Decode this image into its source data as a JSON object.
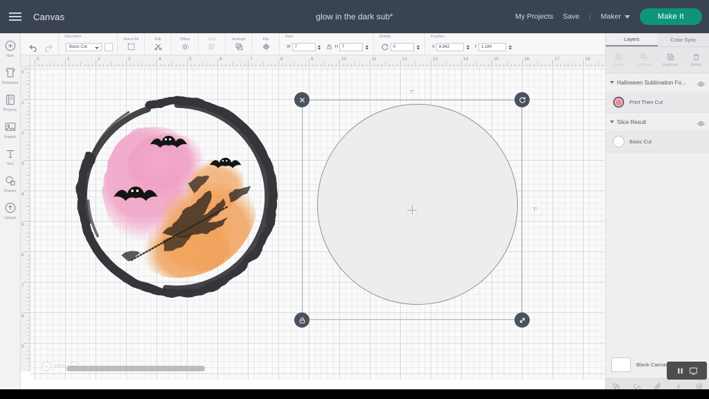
{
  "app": {
    "canvas_label": "Canvas",
    "project_title": "glow in the dark sub*",
    "menu_icon": "hamburger-icon"
  },
  "topbar": {
    "my_projects": "My Projects",
    "save": "Save",
    "separator": "|",
    "machine": "Maker",
    "make_it": "Make It",
    "make_it_color": "#0e9577"
  },
  "left_rail": {
    "items": [
      {
        "label": "New",
        "icon": "plus-circle-icon"
      },
      {
        "label": "Templates",
        "icon": "shirt-icon"
      },
      {
        "label": "Projects",
        "icon": "notebook-icon"
      },
      {
        "label": "Images",
        "icon": "picture-icon"
      },
      {
        "label": "Text",
        "icon": "text-t-icon"
      },
      {
        "label": "Shapes",
        "icon": "shapes-icon"
      },
      {
        "label": "Upload",
        "icon": "upload-cloud-icon"
      }
    ]
  },
  "edit_toolbar": {
    "undo": "undo-icon",
    "redo": "redo-icon",
    "operation": {
      "label": "Operation",
      "value": "Basic Cut",
      "swatch_color": "#ffffff"
    },
    "buttons": [
      {
        "label": "Select All",
        "icon": "select-all-icon",
        "disabled": false
      },
      {
        "label": "Edit",
        "icon": "edit-scissors-icon",
        "disabled": false
      },
      {
        "label": "Offset",
        "icon": "offset-gear-icon",
        "disabled": false
      },
      {
        "label": "Align",
        "icon": "align-icon",
        "disabled": true
      },
      {
        "label": "Arrange",
        "icon": "arrange-icon",
        "disabled": false
      },
      {
        "label": "Flip",
        "icon": "flip-icon",
        "disabled": false
      }
    ],
    "size": {
      "label": "Size",
      "w_key": "W",
      "w_value": "7",
      "h_key": "H",
      "h_value": "7",
      "lock": "lock-aspect-icon"
    },
    "rotate": {
      "label": "Rotate",
      "value": "0",
      "icon": "rotate-icon"
    },
    "position": {
      "label": "Position",
      "x_key": "X",
      "x_value": "8.942",
      "y_key": "Y",
      "y_value": "1.184"
    }
  },
  "rulers": {
    "horizontal": [
      "0",
      "1",
      "2",
      "3",
      "4",
      "5",
      "6",
      "7",
      "8",
      "9",
      "10",
      "11",
      "12",
      "13",
      "14",
      "15",
      "16",
      "17",
      "18"
    ],
    "vertical": [
      "0",
      "1",
      "2",
      "3",
      "4",
      "5",
      "6",
      "7",
      "8",
      "9"
    ],
    "unit": "in"
  },
  "canvas": {
    "zoom_level": "100%",
    "zoom_out": "−",
    "zoom_in": "+",
    "selection": {
      "width_label": "7\"",
      "height_label": "7\"",
      "handles": {
        "top_left": "delete-x-icon",
        "top_right": "rotate-handle-icon",
        "bottom_left": "lock-handle-icon",
        "bottom_right": "resize-handle-icon"
      }
    },
    "artwork": {
      "name": "halloween-sublimation-ring",
      "ring_color": "#35353a",
      "pink_color": "#f09ec4",
      "orange_color": "#f0a15c",
      "bat_color": "#1a1a1a"
    }
  },
  "right_panel": {
    "tabs": [
      {
        "label": "Layers",
        "active": true
      },
      {
        "label": "Color Sync",
        "active": false
      }
    ],
    "actions": [
      {
        "label": "Group",
        "icon": "group-icon",
        "disabled": true
      },
      {
        "label": "UnGroup",
        "icon": "ungroup-icon",
        "disabled": true
      },
      {
        "label": "Duplicate",
        "icon": "duplicate-icon",
        "disabled": false
      },
      {
        "label": "Delete",
        "icon": "trash-icon",
        "disabled": false
      }
    ],
    "layers": [
      {
        "name": "Halloween Sublimation Fo...",
        "visibility_icon": "eye-icon",
        "children": [
          {
            "name": "Print Then Cut",
            "thumb": "artwork-thumb"
          }
        ]
      },
      {
        "name": "Slice Result",
        "visibility_icon": "eye-icon",
        "children": [
          {
            "name": "Basic Cut",
            "thumb": "white-circle-thumb"
          }
        ]
      }
    ],
    "blank_canvas": {
      "label": "Blank Canvas"
    },
    "operations": [
      {
        "label": "Slice",
        "icon": "slice-icon"
      },
      {
        "label": "Weld",
        "icon": "weld-icon"
      },
      {
        "label": "Attach",
        "icon": "attach-paperclip-icon"
      },
      {
        "label": "Flatten",
        "icon": "flatten-icon"
      },
      {
        "label": "Contour",
        "icon": "contour-icon"
      }
    ],
    "overlay_widget": {
      "pause": "pause-icon",
      "screen": "screen-icon"
    }
  }
}
